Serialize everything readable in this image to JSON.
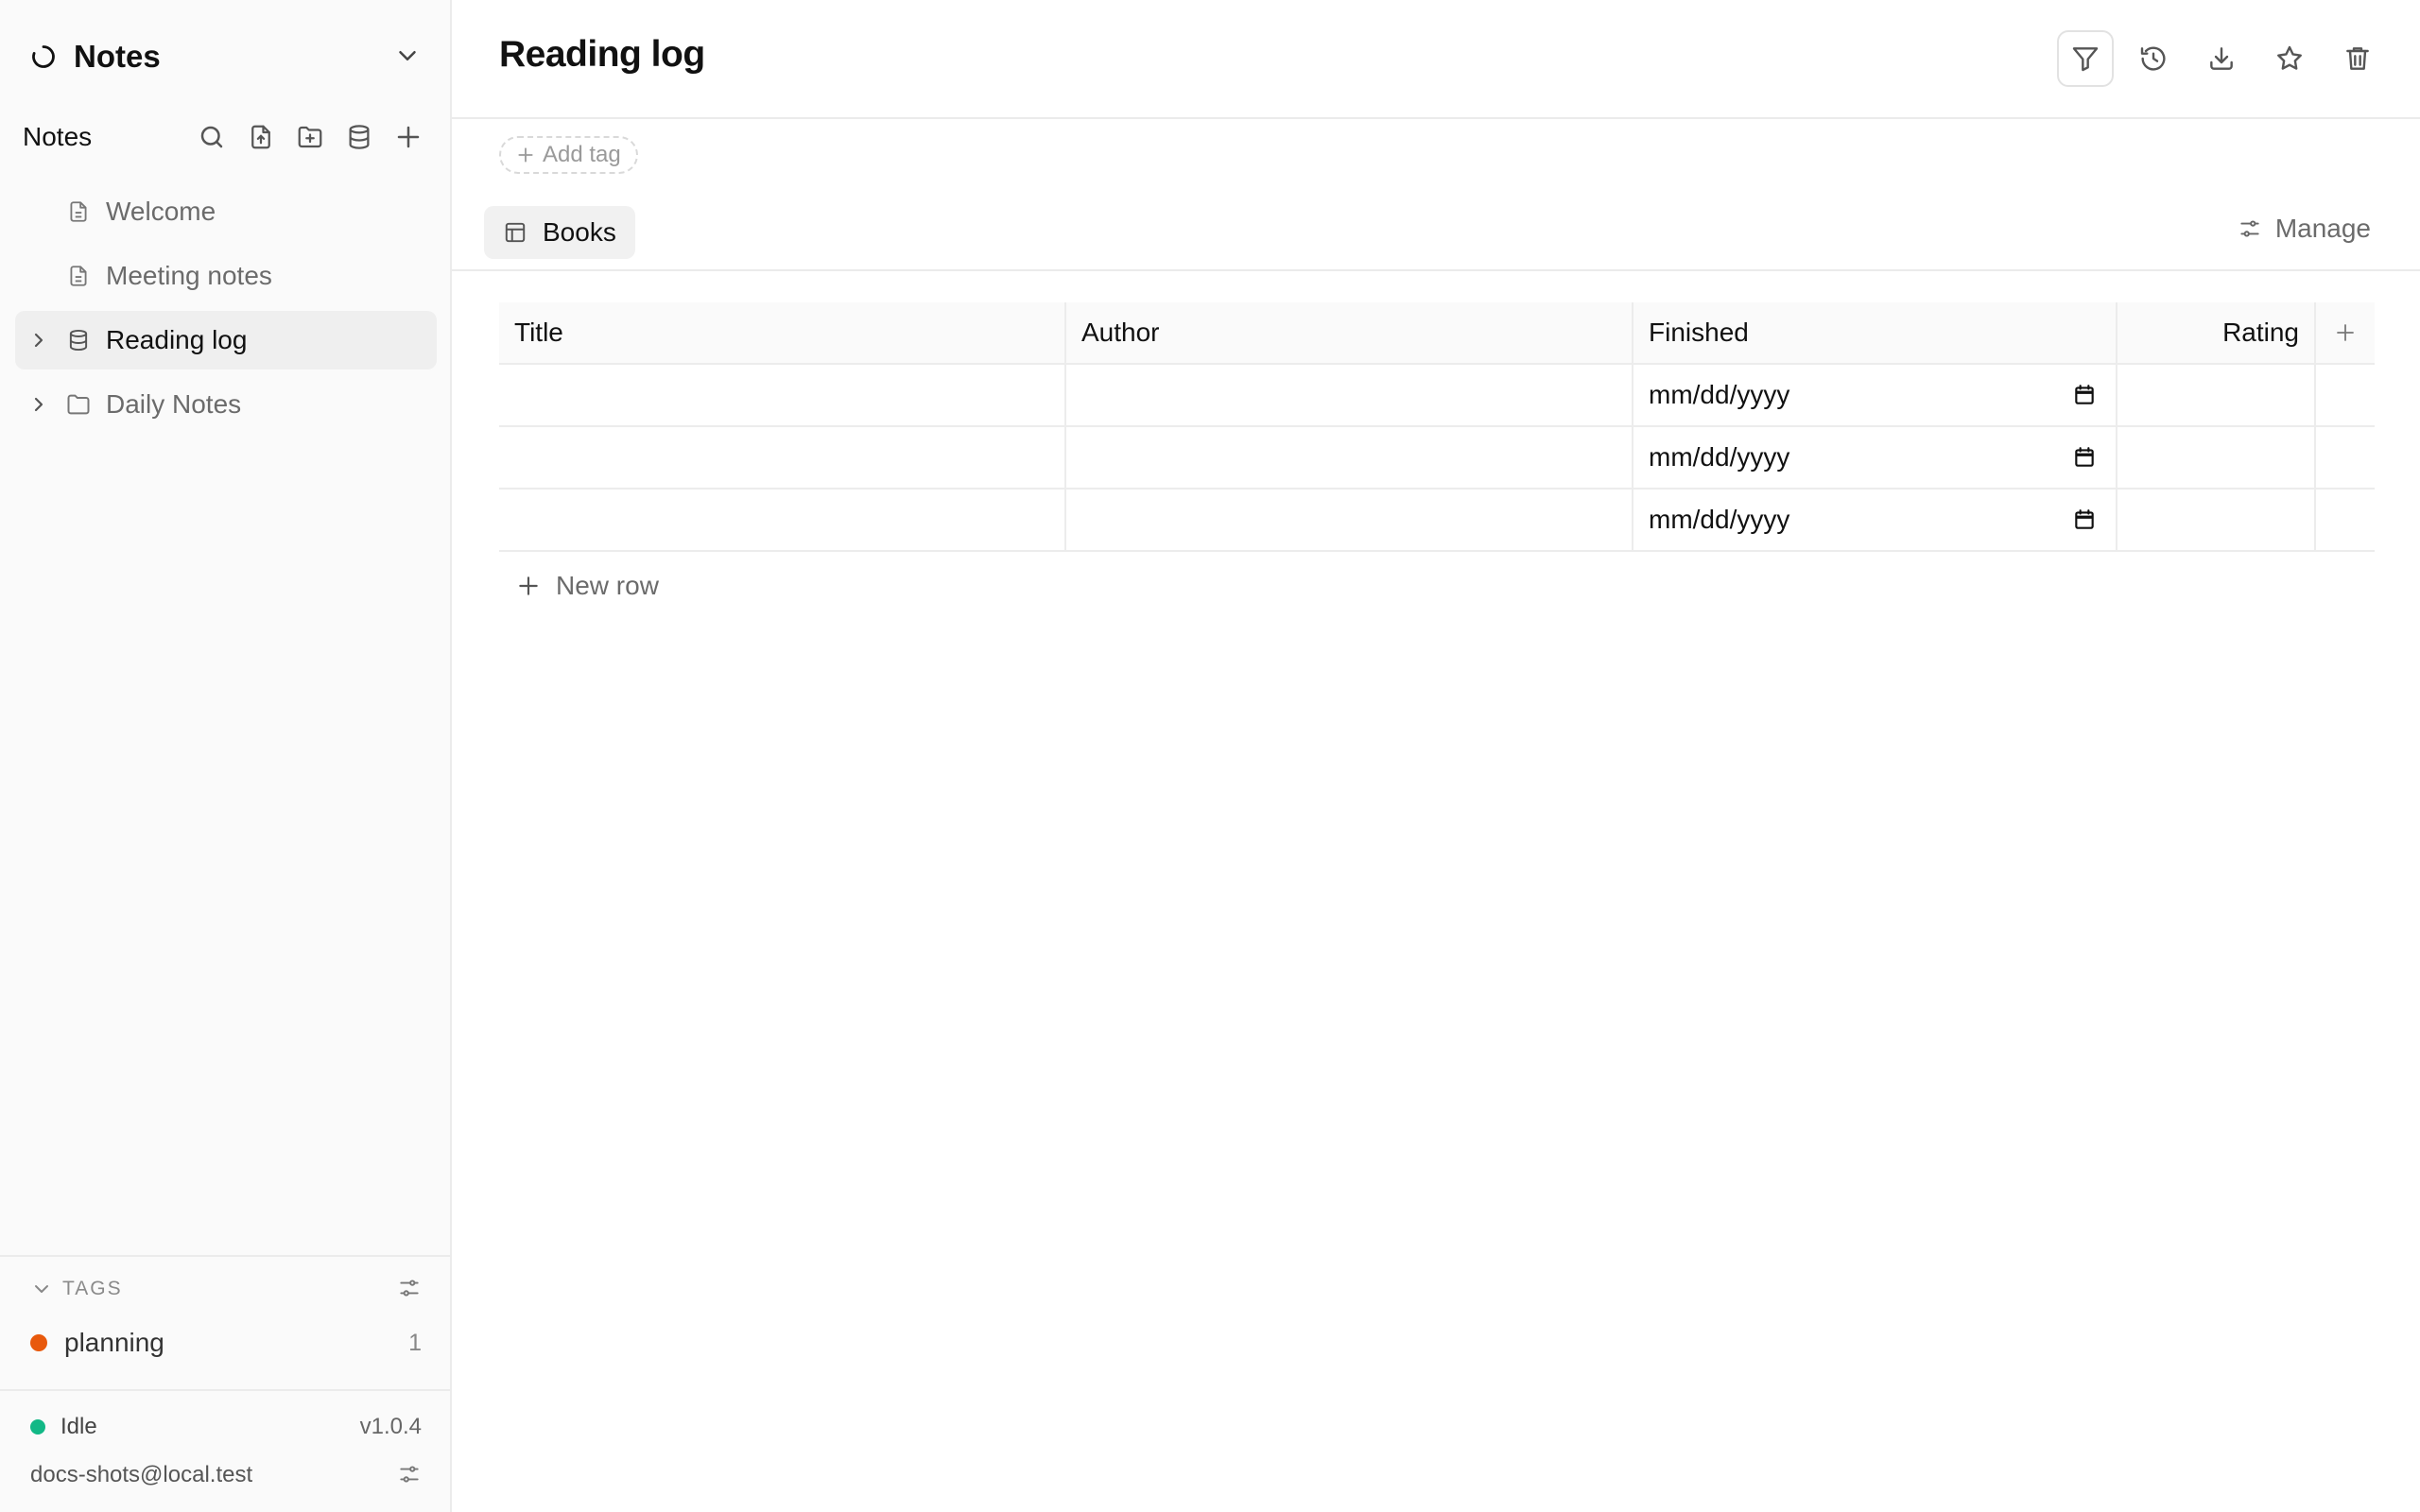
{
  "workspace": {
    "name": "Notes"
  },
  "sidebar": {
    "section_title": "Notes",
    "actions": [
      "search-icon",
      "import-file-icon",
      "new-folder-icon",
      "new-database-icon",
      "add-icon"
    ],
    "tree": [
      {
        "label": "Welcome",
        "icon": "document-icon",
        "expandable": false,
        "active": false
      },
      {
        "label": "Meeting notes",
        "icon": "document-icon",
        "expandable": false,
        "active": false
      },
      {
        "label": "Reading log",
        "icon": "database-icon",
        "expandable": true,
        "active": true
      },
      {
        "label": "Daily Notes",
        "icon": "folder-icon",
        "expandable": true,
        "active": false
      }
    ],
    "tags": {
      "header": "TAGS",
      "items": [
        {
          "name": "planning",
          "count": "1",
          "color": "#e8590c"
        }
      ]
    },
    "status": {
      "state": "Idle",
      "state_color": "#12b886",
      "version": "v1.0.4",
      "user": "docs-shots@local.test"
    }
  },
  "page": {
    "title": "Reading log",
    "top_actions": [
      "filter-icon",
      "history-icon",
      "download-icon",
      "star-icon",
      "trash-icon"
    ],
    "add_tag_label": "Add tag",
    "view_tab": "Books",
    "manage_label": "Manage",
    "table": {
      "columns": [
        "Title",
        "Author",
        "Finished",
        "Rating"
      ],
      "rows": [
        {
          "title": "",
          "author": "",
          "finished": "mm/dd/yyyy",
          "rating": ""
        },
        {
          "title": "",
          "author": "",
          "finished": "mm/dd/yyyy",
          "rating": ""
        },
        {
          "title": "",
          "author": "",
          "finished": "mm/dd/yyyy",
          "rating": ""
        }
      ],
      "new_row_label": "New row"
    }
  }
}
